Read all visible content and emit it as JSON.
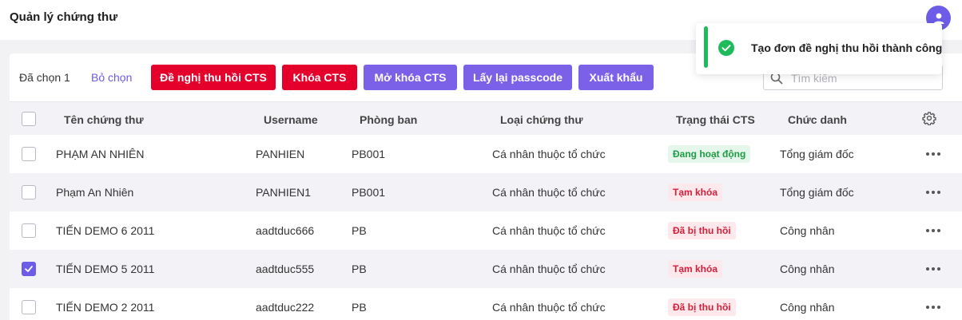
{
  "header": {
    "title": "Quản lý chứng thư",
    "avatar_icon": "user-icon"
  },
  "toolbar": {
    "selected_label": "Đã chọn 1",
    "deselect_label": "Bỏ chọn",
    "buttons": {
      "revoke_request": "Đề nghị thu hồi CTS",
      "lock": "Khóa CTS",
      "unlock": "Mở khóa CTS",
      "get_passcode": "Lấy lại passcode",
      "export": "Xuất khẩu"
    },
    "search_placeholder": "Tìm kiếm"
  },
  "table": {
    "columns": {
      "name": "Tên chứng thư",
      "username": "Username",
      "department": "Phòng ban",
      "cert_type": "Loại chứng thư",
      "status": "Trạng thái CTS",
      "position": "Chức danh"
    },
    "rows": [
      {
        "name": "PHẠM AN NHIÊN",
        "username": "PANHIEN",
        "department": "PB001",
        "cert_type": "Cá nhân thuộc tổ chức",
        "status": "Đang hoạt động",
        "position": "Tổng giám đốc",
        "checked": false
      },
      {
        "name": "Phạm An Nhiên",
        "username": "PANHIEN1",
        "department": "PB001",
        "cert_type": "Cá nhân thuộc tổ chức",
        "status": "Tạm khóa",
        "position": "Tổng giám đốc",
        "checked": false
      },
      {
        "name": "TIẾN DEMO 6 2011",
        "username": "aadtduc666",
        "department": "PB",
        "cert_type": "Cá nhân thuộc tổ chức",
        "status": "Đã bị thu hồi",
        "position": "Công nhân",
        "checked": false
      },
      {
        "name": "TIẾN DEMO 5 2011",
        "username": "aadtduc555",
        "department": "PB",
        "cert_type": "Cá nhân thuộc tổ chức",
        "status": "Tạm khóa",
        "position": "Công nhân",
        "checked": true
      },
      {
        "name": "TIẾN DEMO 2 2011",
        "username": "aadtduc222",
        "department": "PB",
        "cert_type": "Cá nhân thuộc tổ chức",
        "status": "Đã bị thu hồi",
        "position": "Công nhân",
        "checked": false
      }
    ]
  },
  "toast": {
    "message": "Tạo đơn đề nghị thu hồi thành công",
    "icon": "check-circle-icon"
  },
  "colors": {
    "primary": "#6c5ce7",
    "danger": "#e4002b",
    "success": "#1fbb5a"
  }
}
